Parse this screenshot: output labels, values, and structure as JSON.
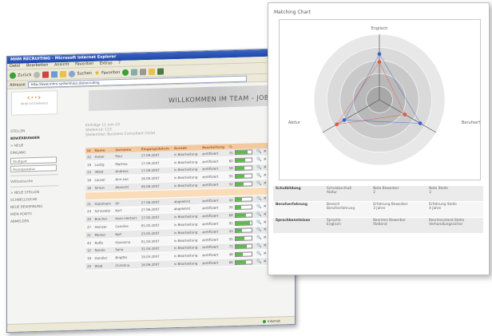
{
  "browser": {
    "title": "MHM RECRUITING - Microsoft Internet Explorer",
    "menu": [
      "Datei",
      "Bearbeiten",
      "Ansicht",
      "Favoriten",
      "Extras",
      "?"
    ],
    "toolbar": {
      "back": "Zurück",
      "search": "Suchen",
      "favorites": "Favoriten"
    },
    "address_label": "Adresse",
    "address": "http://www.mhm-systemhaus.de/recruiting",
    "status_zone": "Internet"
  },
  "site": {
    "logo_text": "MHM-SYSTEMHAUS",
    "welcome": "WILLKOMMEN IM TEAM - JOBS F",
    "nav": {
      "stellen": "STELLEN",
      "bewerbungen": "BEWERBUNGEN",
      "neue": "> NEUE",
      "eingang": "EINGANG",
      "select1": "Stuttgart",
      "select2": "Anzeigestatus",
      "volltext": "Volltextsuche",
      "neue_stellen": "> NEUE STELLEN",
      "schnellsuche": "SCHNELLSUCHE",
      "neue_bewerbung": "NEUE BEWERBUNG",
      "mein_konto": "MEIN KONTO",
      "abmelden": "ABMELDEN"
    },
    "info_line1": "Einträge 11 von 23",
    "info_line2": "Stellen-Id: 123",
    "info_line3": "Stellentitel: Business Consultant (m/w)",
    "columns": [
      "Id",
      "Name",
      "Vorname",
      "Eingangsdatum",
      "Anrede",
      "Bearbeitung",
      "%"
    ],
    "rows": [
      {
        "id": "22",
        "name": "Huber",
        "vorname": "Paul",
        "datum": "17.09.2007",
        "status": "in Bearbeitung",
        "bearb": "zertifiziert",
        "pct": "75",
        "fill": 0.75
      },
      {
        "id": "19",
        "name": "Lustig",
        "vorname": "Martina",
        "datum": "17.09.2007",
        "status": "in Bearbeitung",
        "bearb": "zertifiziert",
        "pct": "60",
        "fill": 0.6
      },
      {
        "id": "23",
        "name": "Illfeld",
        "vorname": "Andreas",
        "datum": "17.09.2007",
        "status": "in Bearbeitung",
        "bearb": "zertifiziert",
        "pct": "58",
        "fill": 0.58
      },
      {
        "id": "16",
        "name": "Lauser",
        "vorname": "Ann-Lea",
        "datum": "16.09.2007",
        "status": "in Bearbeitung",
        "bearb": "zertifiziert",
        "pct": "55",
        "fill": 0.55
      },
      {
        "id": "18",
        "name": "Simon",
        "vorname": "Albrecht",
        "datum": "09.08.2007",
        "status": "in Bearbeitung",
        "bearb": "zertifiziert",
        "pct": "52",
        "fill": 0.52
      },
      {
        "id": "",
        "name": "",
        "vorname": "",
        "datum": "",
        "status": "",
        "bearb": "",
        "pct": "",
        "fill": 0,
        "highlight": true
      },
      {
        "id": "21",
        "name": "Hatzmann",
        "vorname": "Uli",
        "datum": "27.06.2007",
        "status": "abgelehnt",
        "bearb": "zertifiziert",
        "pct": "42",
        "fill": 0.42
      },
      {
        "id": "24",
        "name": "Schneider",
        "vorname": "Kurt",
        "datum": "27.06.2007",
        "status": "abgelehnt",
        "bearb": "zertifiziert",
        "pct": "35",
        "fill": 0.35
      },
      {
        "id": "20",
        "name": "Bracher",
        "vorname": "Hans-Herbert",
        "datum": "17.05.2007",
        "status": "in Bearbeitung",
        "bearb": "zertifiziert",
        "pct": "68",
        "fill": 0.68
      },
      {
        "id": "27",
        "name": "Heinzer",
        "vorname": "Caroline",
        "datum": "05.05.2007",
        "status": "in Bearbeitung",
        "bearb": "zertifiziert",
        "pct": "91",
        "fill": 0.91
      },
      {
        "id": "21",
        "name": "Merkel",
        "vorname": "Rolf",
        "datum": "23.05.2007",
        "status": "in Bearbeitung",
        "bearb": "zertifiziert",
        "pct": "43",
        "fill": 0.43
      },
      {
        "id": "43",
        "name": "Raffa",
        "vorname": "Giovanna",
        "datum": "01.04.2007",
        "status": "in Bearbeitung",
        "bearb": "zertifiziert",
        "pct": "55",
        "fill": 0.55
      },
      {
        "id": "12",
        "name": "Nando",
        "vorname": "Sana",
        "datum": "31.04.2007",
        "status": "in Bearbeitung",
        "bearb": "zertifiziert",
        "pct": "71",
        "fill": 0.71
      },
      {
        "id": "19",
        "name": "Handler",
        "vorname": "Brigitte",
        "datum": "19.03.2007",
        "status": "in Bearbeitung",
        "bearb": "zertifiziert",
        "pct": "48",
        "fill": 0.48
      },
      {
        "id": "20",
        "name": "Wald",
        "vorname": "Christina",
        "datum": "18.06.2007",
        "status": "in Bearbeitung",
        "bearb": "zertifiziert",
        "pct": "66",
        "fill": 0.66
      }
    ]
  },
  "popup": {
    "title": "Matching Chart",
    "axes": [
      "Englisch",
      "Berufserfahrung",
      "Abitur"
    ],
    "rows": [
      {
        "label": "Schulbildung",
        "c1": "Schulabschluß",
        "c1b": "Abitur",
        "c2": "Note Bewerber",
        "c2b": "2",
        "c3": "Note Stelle",
        "c3b": "3"
      },
      {
        "label": "Berufserfahrung",
        "c1": "Bereich",
        "c1b": "Berufserfahrung",
        "c2": "Erfahrung Bewerber",
        "c2b": "3 Jahre",
        "c3": "Erfahrung Stelle",
        "c3b": "4 Jahre"
      },
      {
        "label": "Sprachkenntnisse",
        "c1": "Sprache",
        "c1b": "Englisch",
        "c2": "Kenntnis Bewerber",
        "c2b": "fließend",
        "c3": "Kenntnisstand Stelle",
        "c3b": "Verhandlungssicher"
      }
    ]
  },
  "chart_data": {
    "type": "radar",
    "title": "Matching Chart",
    "axes": [
      "Englisch",
      "Berufserfahrung",
      "Abitur"
    ],
    "levels": 5,
    "series": [
      {
        "values": [
          0.7,
          0.72,
          0.62
        ],
        "color": "#3a5fd0"
      },
      {
        "values": [
          0.58,
          0.45,
          0.75
        ],
        "color": "#e4574a"
      }
    ],
    "colors": {
      "applicant": "#3a5fd0",
      "position": "#e4574a",
      "rings": [
        "#e8e8e8",
        "#dadada",
        "#c9c9c9",
        "#b9b9b9",
        "#a8a8a8"
      ]
    }
  }
}
